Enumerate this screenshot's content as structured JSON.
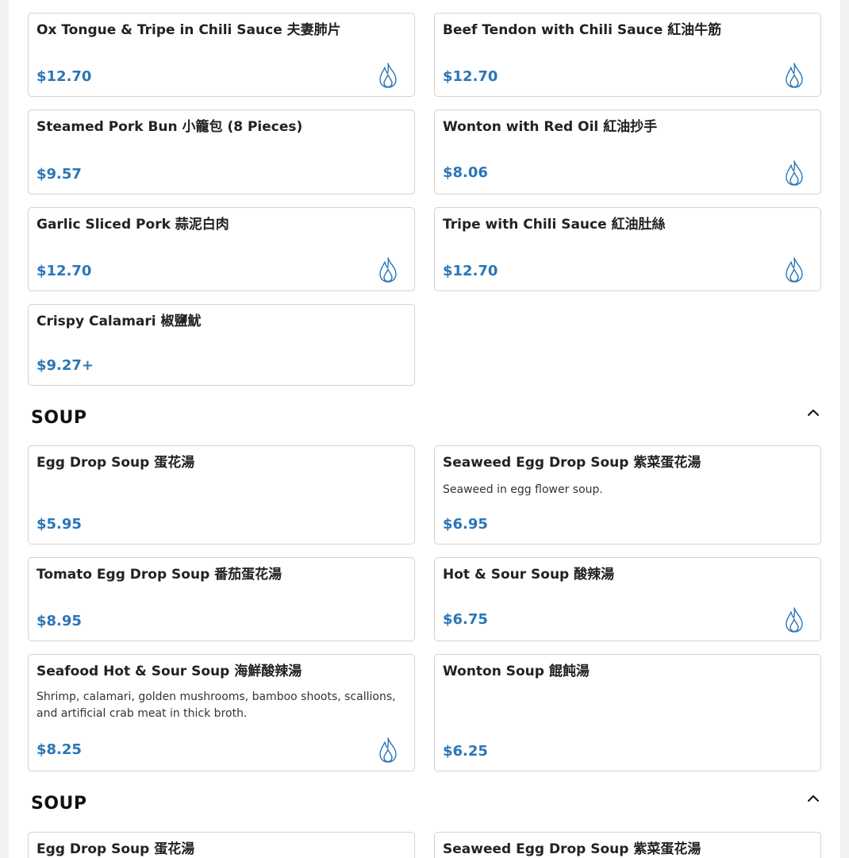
{
  "section1": {
    "items": [
      {
        "title": "Ox Tongue & Tripe in Chili Sauce 夫妻肺片",
        "price": "$12.70",
        "spicy": true
      },
      {
        "title": "Beef Tendon with Chili Sauce 紅油牛筋",
        "price": "$12.70",
        "spicy": true
      },
      {
        "title": "Steamed Pork Bun 小籠包 (8 Pieces)",
        "price": "$9.57",
        "spicy": false
      },
      {
        "title": "Wonton with Red Oil 紅油抄手",
        "price": "$8.06",
        "spicy": true
      },
      {
        "title": "Garlic Sliced Pork 蒜泥白肉",
        "price": "$12.70",
        "spicy": true
      },
      {
        "title": "Tripe with Chili Sauce 紅油肚絲",
        "price": "$12.70",
        "spicy": true
      },
      {
        "title": "Crispy Calamari 椒鹽魷",
        "price": "$9.27+",
        "spicy": false
      }
    ]
  },
  "soup": {
    "title": "SOUP",
    "items": [
      {
        "title": "Egg Drop Soup 蛋花湯",
        "price": "$5.95",
        "spicy": false
      },
      {
        "title": "Seaweed Egg Drop Soup 紫菜蛋花湯",
        "description": "Seaweed in egg flower soup.",
        "price": "$6.95",
        "spicy": false
      },
      {
        "title": "Tomato Egg Drop Soup 番茄蛋花湯",
        "price": "$8.95",
        "spicy": false
      },
      {
        "title": "Hot & Sour Soup 酸辣湯",
        "price": "$6.75",
        "spicy": true
      },
      {
        "title": "Seafood Hot & Sour Soup 海鮮酸辣湯",
        "description": "Shrimp, calamari, golden mushrooms, bamboo shoots, scallions, and artificial crab meat in thick broth.",
        "price": "$8.25",
        "spicy": true
      },
      {
        "title": "Wonton Soup 餛飩湯",
        "price": "$6.25",
        "spicy": false
      }
    ]
  },
  "soup2": {
    "title": "SOUP",
    "items": [
      {
        "title": "Egg Drop Soup 蛋花湯"
      },
      {
        "title": "Seaweed Egg Drop Soup 紫菜蛋花湯"
      }
    ]
  },
  "icons": {
    "spicy": "flame-icon",
    "collapse": "chevron-up-icon"
  },
  "colors": {
    "price": "#2a76b8",
    "flame": "#2a76b8"
  }
}
